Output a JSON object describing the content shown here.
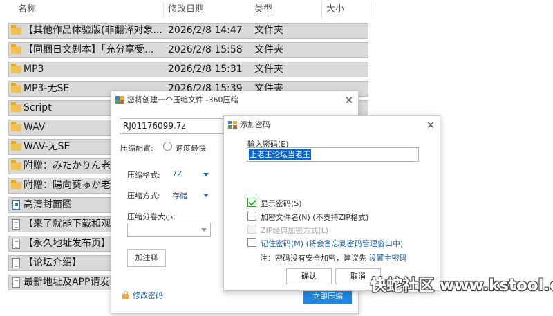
{
  "explorer": {
    "columns": {
      "name": "名称",
      "modified": "修改日期",
      "type": "类型",
      "size": "大小"
    },
    "files": [
      {
        "icon": "folder-icon",
        "name": "【其他作品体验版(非翻译对象...",
        "date": "2026/2/8 14:47",
        "type": "文件夹"
      },
      {
        "icon": "folder-icon",
        "name": "【同梱日文剧本】「充分享受...",
        "date": "2026/2/8 15:58",
        "type": "文件夹"
      },
      {
        "icon": "folder-icon",
        "name": "MP3",
        "date": "2026/2/8 15:31",
        "type": "文件夹"
      },
      {
        "icon": "folder-icon",
        "name": "MP3-无SE",
        "date": "2026/2/8 15:39",
        "type": "文件夹"
      },
      {
        "icon": "folder-icon",
        "name": "Script",
        "date": "",
        "type": ""
      },
      {
        "icon": "folder-icon",
        "name": "WAV",
        "date": "",
        "type": ""
      },
      {
        "icon": "folder-icon",
        "name": "WAV-无SE",
        "date": "",
        "type": ""
      },
      {
        "icon": "folder-icon",
        "name": "附赠：みたかりん老",
        "date": "",
        "type": ""
      },
      {
        "icon": "folder-icon",
        "name": "附赠：陽向葵ゅか老",
        "date": "",
        "type": ""
      },
      {
        "icon": "image-file-icon",
        "name": "高清封面图",
        "date": "",
        "type": ""
      },
      {
        "icon": "text-file-icon",
        "name": "【来了就能下载和观",
        "date": "",
        "type": ""
      },
      {
        "icon": "text-file-icon",
        "name": "【永久地址发布页】",
        "date": "",
        "type": ""
      },
      {
        "icon": "text-file-icon",
        "name": "【论坛介绍】",
        "date": "",
        "type": ""
      },
      {
        "icon": "text-file-icon",
        "name": "最新地址及APP请发",
        "date": "",
        "type": ""
      }
    ]
  },
  "compress_dialog": {
    "title": "您将创建一个压缩文件 -360压缩",
    "filename": "RJ01176099.7z",
    "config_label": "压缩配置:",
    "config_option": "速度最快",
    "format_label": "压缩格式:",
    "format_value": "7Z",
    "method_label": "压缩方式:",
    "method_value": "存储",
    "volume_label": "压缩分卷大小:",
    "comment_button": "加注释",
    "change_password_link": "修改密码",
    "start_button": "立即压缩"
  },
  "password_dialog": {
    "title": "添加密码",
    "input_label": "输入密码(E)",
    "password_value": "上老王论坛当老王",
    "options": [
      {
        "label": "显示密码(S)",
        "checked": true,
        "disabled": false
      },
      {
        "label": "加密文件名(N) (不支持ZIP格式)",
        "checked": false,
        "disabled": false
      },
      {
        "label": "ZIP经典加密方式(L)",
        "checked": false,
        "disabled": true
      },
      {
        "label": "记住密码(M) (将会备忘到密码管理窗口中)",
        "checked": false,
        "disabled": false
      }
    ],
    "note_text": "注：密码没有安全加密，建议先",
    "note_link": "设置主密码",
    "ok_button": "确认",
    "cancel_button": "取消"
  },
  "watermark": "快蛇社区 www.kstool.cc",
  "colors": {
    "accent_blue": "#1e88e5",
    "link_blue": "#1f5fa8",
    "selection_blue": "#0a64d8",
    "folder_yellow": "#f2c14e",
    "row_gray": "#d9d9d9"
  }
}
